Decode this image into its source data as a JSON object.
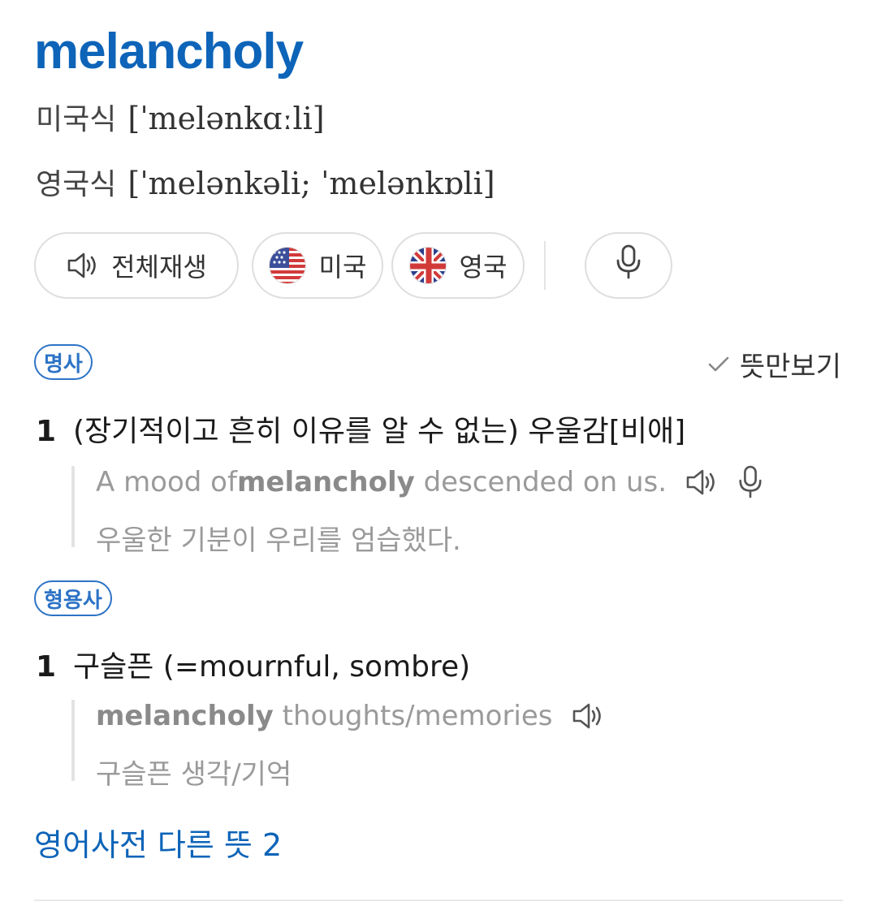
{
  "entry": {
    "word": "melancholy",
    "pron_us_label": "미국식",
    "pron_us_ipa": "[ˈmelənkɑːli]",
    "pron_uk_label": "영국식",
    "pron_uk_ipa": "[ˈmelənkəli; ˈmelənkɒli]"
  },
  "buttons": {
    "play_all": "전체재생",
    "us": "미국",
    "uk": "영국",
    "mic_icon": "mic-icon",
    "speaker_icon": "speaker-icon"
  },
  "meaning_only": "뜻만보기",
  "senses": [
    {
      "pos": "명사",
      "number": "1",
      "definition": "(장기적이고 흔히 이유를 알 수 없는) 우울감[비애]",
      "example_before": "A mood of ",
      "example_bold": "melancholy",
      "example_after": " descended on us.",
      "example_ko": "우울한 기분이 우리를 엄습했다."
    },
    {
      "pos": "형용사",
      "number": "1",
      "definition": "구슬픈 (=mournful, sombre)",
      "example_before": "",
      "example_bold": "melancholy",
      "example_after": " thoughts/memories",
      "example_ko": "구슬픈 생각/기억"
    }
  ],
  "more_link": "영어사전 다른 뜻 2",
  "colors": {
    "brand_blue": "#0d64b8",
    "tag_blue": "#2c73c6",
    "example_gray": "#9a9a9a"
  }
}
